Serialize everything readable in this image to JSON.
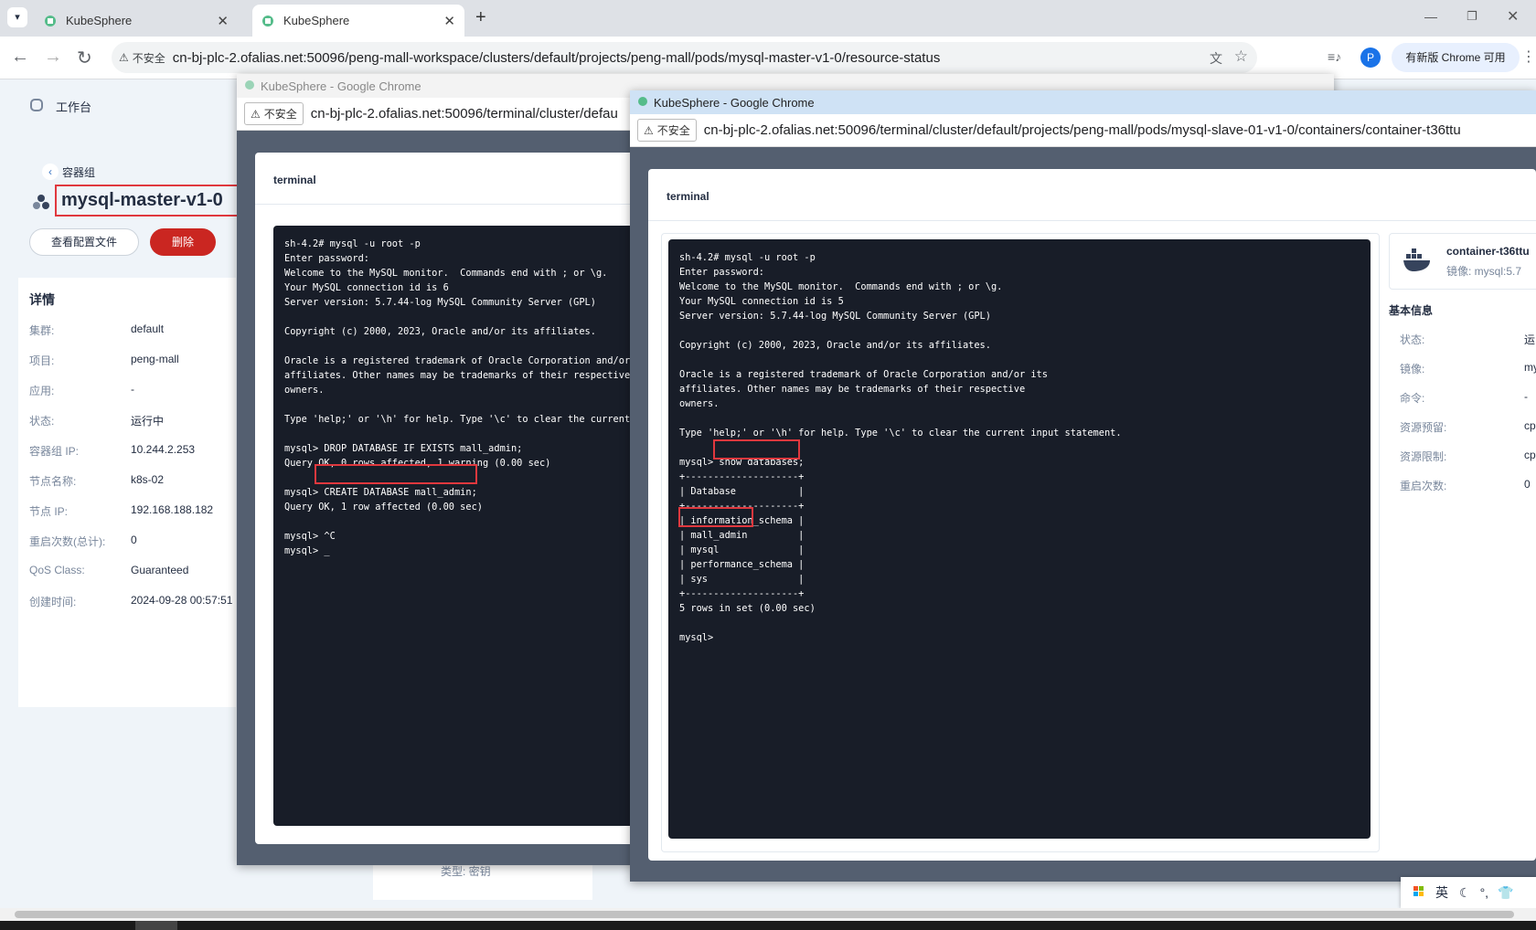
{
  "browser": {
    "tabs": [
      {
        "title": "KubeSphere",
        "active": false
      },
      {
        "title": "KubeSphere",
        "active": true
      }
    ],
    "new_tab": "+",
    "security_label": "不安全",
    "url": "cn-bj-plc-2.ofalias.net:50096/peng-mall-workspace/clusters/default/projects/peng-mall/pods/mysql-master-v1-0/resource-status",
    "profile_initial": "P",
    "update_label": "有新版 Chrome 可用"
  },
  "left": {
    "workbench": "工作台",
    "back_label": "容器组",
    "pod_name": "mysql-master-v1-0",
    "view_config_button": "查看配置文件",
    "delete_button": "删除",
    "details_title": "详情",
    "details": [
      {
        "key": "集群:",
        "value": "default"
      },
      {
        "key": "项目:",
        "value": "peng-mall"
      },
      {
        "key": "应用:",
        "value": "-"
      },
      {
        "key": "状态:",
        "value": "运行中"
      },
      {
        "key": "容器组 IP:",
        "value": "10.244.2.253"
      },
      {
        "key": "节点名称:",
        "value": "k8s-02"
      },
      {
        "key": "节点 IP:",
        "value": "192.168.188.182"
      },
      {
        "key": "重启次数(总计):",
        "value": "0"
      },
      {
        "key": "QoS Class:",
        "value": "Guaranteed"
      },
      {
        "key": "创建时间:",
        "value": "2024-09-28 00:57:51"
      }
    ],
    "secret_type": "类型: 密钥"
  },
  "window1": {
    "title": "KubeSphere - Google Chrome",
    "security_label": "不安全",
    "url": "cn-bj-plc-2.ofalias.net:50096/terminal/cluster/defau",
    "header": "terminal",
    "terminal_text": "sh-4.2# mysql -u root -p\nEnter password:\nWelcome to the MySQL monitor.  Commands end with ; or \\g.\nYour MySQL connection id is 6\nServer version: 5.7.44-log MySQL Community Server (GPL)\n\nCopyright (c) 2000, 2023, Oracle and/or its affiliates.\n\nOracle is a registered trademark of Oracle Corporation and/or i\naffiliates. Other names may be trademarks of their respective\nowners.\n\nType 'help;' or '\\h' for help. Type '\\c' to clear the current i\n\nmysql> DROP DATABASE IF EXISTS mall_admin;\nQuery OK, 0 rows affected, 1 warning (0.00 sec)\n\nmysql> CREATE DATABASE mall_admin;\nQuery OK, 1 row affected (0.00 sec)\n\nmysql> ^C\nmysql> _"
  },
  "window2": {
    "title": "KubeSphere - Google Chrome",
    "security_label": "不安全",
    "url": "cn-bj-plc-2.ofalias.net:50096/terminal/cluster/default/projects/peng-mall/pods/mysql-slave-01-v1-0/containers/container-t36ttu",
    "header": "terminal",
    "terminal_text": "sh-4.2# mysql -u root -p\nEnter password:\nWelcome to the MySQL monitor.  Commands end with ; or \\g.\nYour MySQL connection id is 5\nServer version: 5.7.44-log MySQL Community Server (GPL)\n\nCopyright (c) 2000, 2023, Oracle and/or its affiliates.\n\nOracle is a registered trademark of Oracle Corporation and/or its\naffiliates. Other names may be trademarks of their respective\nowners.\n\nType 'help;' or '\\h' for help. Type '\\c' to clear the current input statement.\n\nmysql> show databases;\n+--------------------+\n| Database           |\n+--------------------+\n| information_schema |\n| mall_admin         |\n| mysql              |\n| performance_schema |\n| sys                |\n+--------------------+\n5 rows in set (0.00 sec)\n\nmysql> ",
    "container_name": "container-t36ttu",
    "container_image": "镜像: mysql:5.7",
    "basic_info_title": "基本信息",
    "basic_info": [
      {
        "key": "状态:",
        "value": "运"
      },
      {
        "key": "镜像:",
        "value": "my"
      },
      {
        "key": "命令:",
        "value": "-"
      },
      {
        "key": "资源预留:",
        "value": "cp"
      },
      {
        "key": "资源限制:",
        "value": "cp"
      },
      {
        "key": "重启次数:",
        "value": "0"
      }
    ]
  },
  "ime": {
    "lang": "英"
  },
  "colors": {
    "accent_red": "#ca2621",
    "highlight": "#e0383e",
    "terminal_bg": "#181d28",
    "kube_green": "#55bc8a"
  }
}
